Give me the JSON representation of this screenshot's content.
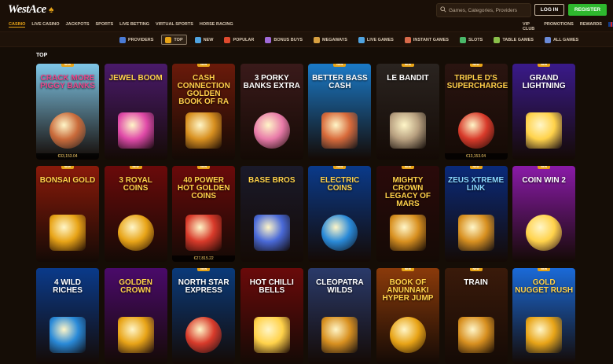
{
  "header": {
    "logo": "WestAce",
    "search_placeholder": "Games, Categories, Providers",
    "login_label": "LOG IN",
    "register_label": "REGISTER"
  },
  "nav": {
    "left": [
      "CASINO",
      "LIVE CASINO",
      "JACKPOTS",
      "SPORTS",
      "LIVE BETTING",
      "VIRTUAL SPORTS",
      "HORSE RACING"
    ],
    "right": [
      "VIP CLUB",
      "PROMOTIONS",
      "REWARDS"
    ]
  },
  "categories": [
    {
      "label": "PROVIDERS",
      "color": "#4a7bd6"
    },
    {
      "label": "TOP",
      "color": "#e8a417"
    },
    {
      "label": "NEW",
      "color": "#4fa3e0"
    },
    {
      "label": "POPULAR",
      "color": "#e04a2e"
    },
    {
      "label": "BONUS BUYS",
      "color": "#a06ad8"
    },
    {
      "label": "MEGAWAYS",
      "color": "#d8a040"
    },
    {
      "label": "LIVE GAMES",
      "color": "#4fa3e0"
    },
    {
      "label": "INSTANT GAMES",
      "color": "#d86a4a"
    },
    {
      "label": "SLOTS",
      "color": "#4ab86a"
    },
    {
      "label": "TABLE GAMES",
      "color": "#8ac04a"
    },
    {
      "label": "ALL GAMES",
      "color": "#6a8ad8"
    }
  ],
  "section_title": "TOP",
  "badge_label": "NEW",
  "games": [
    {
      "name": "CRACK MORE PIGGY BANKS",
      "badge": true,
      "jackpot": "€33,153.04",
      "bg": "#7fc7e8",
      "fg": "#e8458a",
      "art": "#c96a3a"
    },
    {
      "name": "JEWEL BOOM",
      "badge": false,
      "jackpot": "",
      "bg": "#4a1a6a",
      "fg": "#ffd24a",
      "art": "#e04aa8"
    },
    {
      "name": "CASH CONNECTION GOLDEN BOOK OF RA",
      "badge": true,
      "jackpot": "",
      "bg": "#6a1a0a",
      "fg": "#ffcf4a",
      "art": "#d89020"
    },
    {
      "name": "3 PORKY BANKS EXTRA",
      "badge": false,
      "jackpot": "",
      "bg": "#3a1a1a",
      "fg": "#ffffff",
      "art": "#e87aa8"
    },
    {
      "name": "BETTER BASS CASH",
      "badge": true,
      "jackpot": "",
      "bg": "#1a7ac8",
      "fg": "#ffffff",
      "art": "#d86a3a"
    },
    {
      "name": "LE BANDIT",
      "badge": true,
      "jackpot": "",
      "bg": "#2a2420",
      "fg": "#ffffff",
      "art": "#b8a080"
    },
    {
      "name": "TRIPLE D'S SUPERCHARGE",
      "badge": true,
      "jackpot": "€13,153.04",
      "bg": "#2a1410",
      "fg": "#ffcf4a",
      "art": "#d83a2a"
    },
    {
      "name": "GRAND LIGHTNING",
      "badge": true,
      "jackpot": "",
      "bg": "#3a1a8a",
      "fg": "#ffffff",
      "art": "#ffd24a"
    },
    {
      "name": "BONSAI GOLD",
      "badge": true,
      "jackpot": "",
      "bg": "#8a1a0a",
      "fg": "#ffd24a",
      "art": "#e8a417"
    },
    {
      "name": "3 ROYAL COINS",
      "badge": true,
      "jackpot": "",
      "bg": "#6a0a0a",
      "fg": "#ffd24a",
      "art": "#e8a417"
    },
    {
      "name": "40 POWER HOT GOLDEN COINS",
      "badge": true,
      "jackpot": "€27,815.22",
      "bg": "#6a0a0a",
      "fg": "#ffd24a",
      "art": "#d83a2a"
    },
    {
      "name": "BASE BROS",
      "badge": false,
      "jackpot": "",
      "bg": "#1a1a2a",
      "fg": "#ffd24a",
      "art": "#4a6ad8"
    },
    {
      "name": "ELECTRIC COINS",
      "badge": true,
      "jackpot": "",
      "bg": "#0a3a8a",
      "fg": "#ffd24a",
      "art": "#2a8ad8"
    },
    {
      "name": "MIGHTY CROWN LEGACY OF MARS",
      "badge": true,
      "jackpot": "",
      "bg": "#2a0a0a",
      "fg": "#ffd24a",
      "art": "#d89020"
    },
    {
      "name": "ZEUS XTREME LINK",
      "badge": true,
      "jackpot": "",
      "bg": "#0a2a7a",
      "fg": "#8ad8ff",
      "art": "#d89020"
    },
    {
      "name": "COIN WIN 2",
      "badge": true,
      "jackpot": "",
      "bg": "#8a1aa8",
      "fg": "#ffffff",
      "art": "#ffd24a"
    },
    {
      "name": "4 WILD RICHES",
      "badge": false,
      "jackpot": "",
      "bg": "#0a3a8a",
      "fg": "#ffffff",
      "art": "#2a8ad8"
    },
    {
      "name": "GOLDEN CROWN",
      "badge": false,
      "jackpot": "",
      "bg": "#4a0a6a",
      "fg": "#ffd24a",
      "art": "#e8a417"
    },
    {
      "name": "NORTH STAR EXPRESS",
      "badge": true,
      "jackpot": "",
      "bg": "#0a3a7a",
      "fg": "#ffffff",
      "art": "#d83a2a"
    },
    {
      "name": "HOT CHILLI BELLS",
      "badge": false,
      "jackpot": "",
      "bg": "#6a0a0a",
      "fg": "#ffffff",
      "art": "#ffd24a"
    },
    {
      "name": "CLEOPATRA WILDS",
      "badge": false,
      "jackpot": "",
      "bg": "#2a3a6a",
      "fg": "#ffffff",
      "art": "#d89020"
    },
    {
      "name": "BOOK OF ANUNNAKI HYPER JUMP",
      "badge": true,
      "jackpot": "",
      "bg": "#8a3a0a",
      "fg": "#ffd24a",
      "art": "#e8a417"
    },
    {
      "name": "TRAIN",
      "badge": true,
      "jackpot": "",
      "bg": "#3a1a0a",
      "fg": "#ffffff",
      "art": "#d89020"
    },
    {
      "name": "GOLD NUGGET RUSH",
      "badge": true,
      "jackpot": "",
      "bg": "#1a6ad8",
      "fg": "#ffd24a",
      "art": "#e8a417"
    }
  ]
}
